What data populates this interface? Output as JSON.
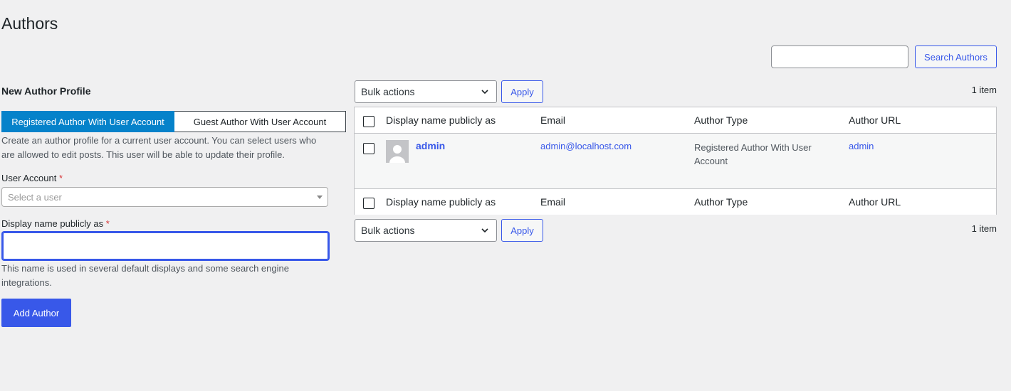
{
  "page": {
    "title": "Authors"
  },
  "search": {
    "value": "",
    "button_label": "Search Authors"
  },
  "form": {
    "heading": "New Author Profile",
    "tabs": [
      {
        "label": "Registered Author With User Account",
        "active": true
      },
      {
        "label": "Guest Author With User Account",
        "active": false
      }
    ],
    "help_text": "Create an author profile for a current user account. You can select users who are allowed to edit posts. This user will be able to update their profile.",
    "user_account_label": "User Account",
    "required_mark": "*",
    "user_select_placeholder": "Select a user",
    "display_name_label": "Display name publicly as",
    "display_name_value": "",
    "display_name_help": "This name is used in several default displays and some search engine integrations.",
    "submit_label": "Add Author"
  },
  "list": {
    "bulk_actions_label": "Bulk actions",
    "apply_label": "Apply",
    "item_count": "1 item",
    "columns": {
      "name": "Display name publicly as",
      "email": "Email",
      "type": "Author Type",
      "url": "Author URL"
    },
    "rows": [
      {
        "name": "admin",
        "email": "admin@localhost.com",
        "type": "Registered Author With User Account",
        "url": "admin"
      }
    ]
  },
  "colors": {
    "accent": "#3858e9",
    "tab_active": "#0582ca",
    "required": "#d63638",
    "background": "#f0f0f1"
  }
}
